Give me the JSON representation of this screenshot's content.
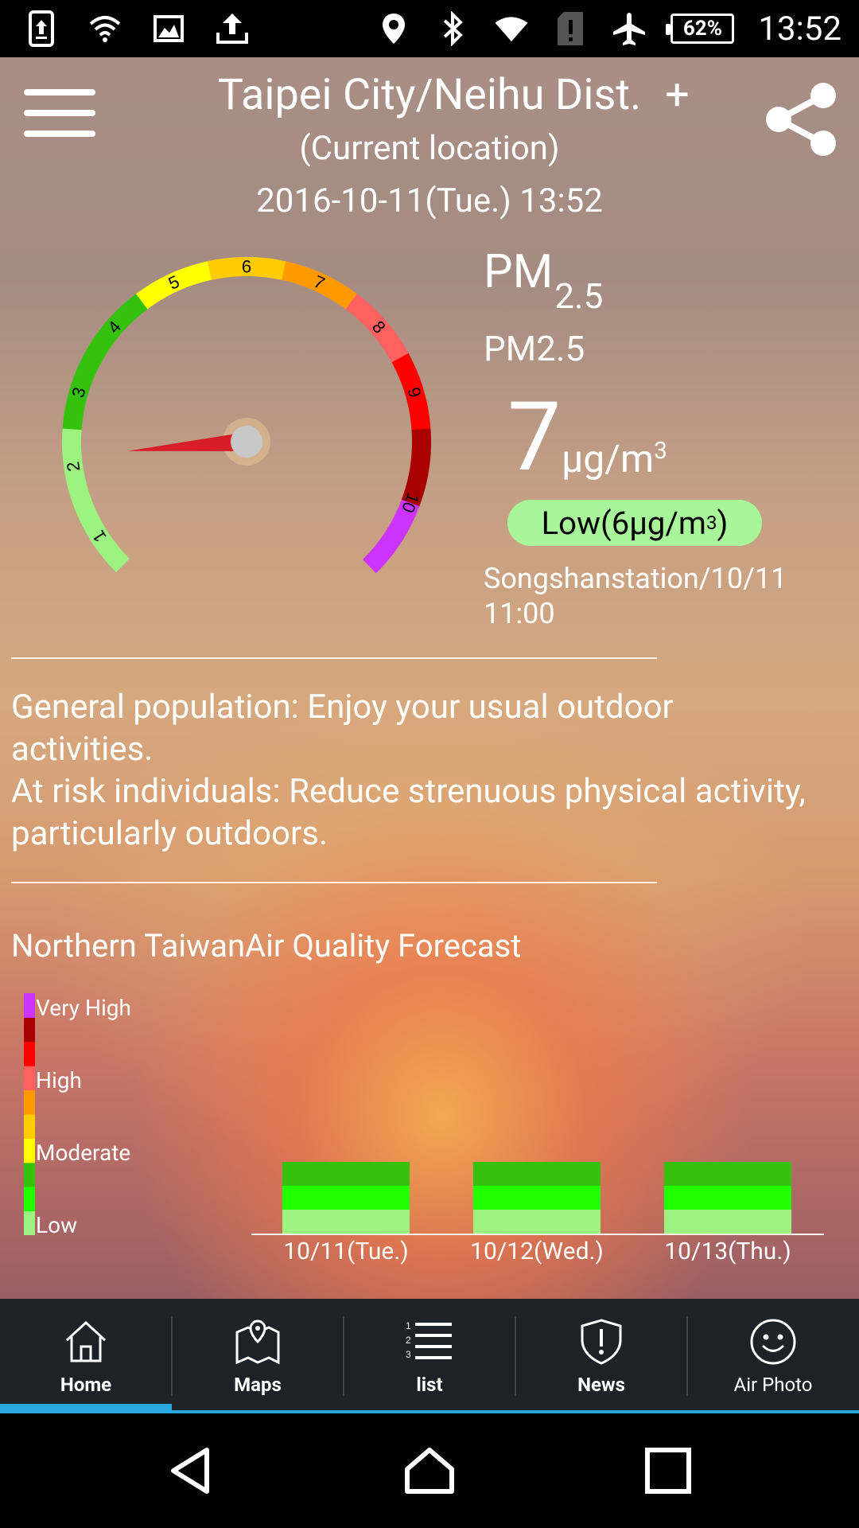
{
  "status_bar": {
    "time": "13:52",
    "battery": "62%",
    "icons_left": [
      "upload-phone-icon",
      "wifi-icon",
      "image-icon",
      "upload-icon"
    ],
    "icons_right": [
      "location-icon",
      "bluetooth-icon",
      "wifi-signal-icon",
      "sim-alert-icon",
      "airplane-icon",
      "battery-icon"
    ]
  },
  "header": {
    "location": "Taipei City/Neihu Dist.",
    "add_label": "+",
    "sublabel": "(Current location)",
    "datetime": "2016-10-11(Tue.) 13:52"
  },
  "gauge": {
    "ticks": [
      "1",
      "2",
      "3",
      "4",
      "5",
      "6",
      "7",
      "8",
      "9",
      "10"
    ],
    "current_level": 2,
    "colors": [
      "#9cf37f",
      "#9cf37f",
      "#35c20e",
      "#35c20e",
      "#ffff00",
      "#ffcc00",
      "#ff9900",
      "#ff6060",
      "#ff0000",
      "#a80000",
      "#cc33ff"
    ]
  },
  "reading": {
    "pollutant_main": "PM",
    "pollutant_sub": "2.5",
    "pollutant_name": "PM2.5",
    "value": "7",
    "unit": "μg/m",
    "unit_sup": "3",
    "level_text": "Low(6μg/m",
    "level_sup": "3",
    "level_close": ")",
    "level_color": "#a8f59a",
    "station_line1": "Songshanstation/10/11",
    "station_line2": "11:00"
  },
  "advice": {
    "line1": "General population: Enjoy your usual outdoor activities.",
    "line2": "At risk individuals: Reduce strenuous physical activity, particularly outdoors."
  },
  "forecast": {
    "title": "Northern TaiwanAir Quality Forecast",
    "legend": [
      "Very High",
      "High",
      "Moderate",
      "Low"
    ]
  },
  "chart_data": {
    "type": "bar",
    "categories": [
      "10/11(Tue.)",
      "10/12(Wed.)",
      "10/13(Thu.)"
    ],
    "values": [
      3,
      3,
      3
    ],
    "level_names": [
      "Very High",
      "High",
      "Moderate",
      "Low"
    ],
    "scale_colors": [
      "#9cf37f",
      "#1fff00",
      "#35c20e",
      "#ffff00",
      "#ffcc00",
      "#ff9900",
      "#ff6060",
      "#ff0000",
      "#a80000",
      "#cc33ff"
    ],
    "ylim": [
      0,
      10
    ]
  },
  "bottom_nav": {
    "items": [
      {
        "label": "Home",
        "icon": "home-icon",
        "active": true
      },
      {
        "label": "Maps",
        "icon": "map-icon",
        "active": false
      },
      {
        "label": "list",
        "icon": "list-icon",
        "active": false
      },
      {
        "label": "News",
        "icon": "alert-shield-icon",
        "active": false
      },
      {
        "label": "Air Photo",
        "icon": "smiley-icon",
        "active": false
      }
    ]
  }
}
